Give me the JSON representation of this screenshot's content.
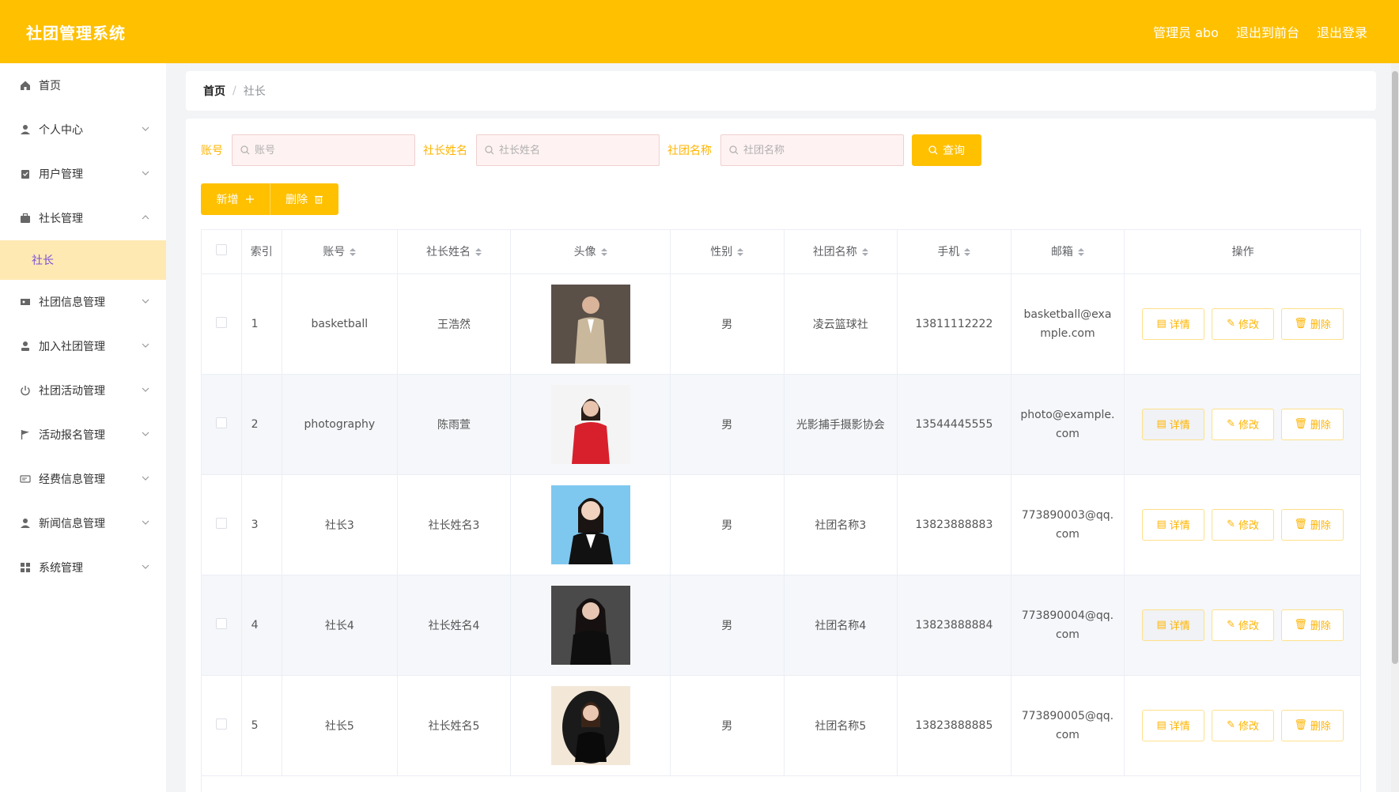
{
  "header": {
    "title": "社团管理系统",
    "admin_label": "管理员 abo",
    "front_label": "退出到前台",
    "logout_label": "退出登录"
  },
  "sidebar": {
    "items": [
      {
        "label": "首页",
        "icon": "home-icon"
      },
      {
        "label": "个人中心",
        "icon": "user-icon"
      },
      {
        "label": "用户管理",
        "icon": "clipboard-icon"
      },
      {
        "label": "社长管理",
        "icon": "briefcase-icon"
      },
      {
        "label": "社团信息管理",
        "icon": "ticket-icon"
      },
      {
        "label": "加入社团管理",
        "icon": "person-icon"
      },
      {
        "label": "社团活动管理",
        "icon": "power-icon"
      },
      {
        "label": "活动报名管理",
        "icon": "flag-icon"
      },
      {
        "label": "经费信息管理",
        "icon": "card-icon"
      },
      {
        "label": "新闻信息管理",
        "icon": "person-icon"
      },
      {
        "label": "系统管理",
        "icon": "grid-icon"
      }
    ],
    "sub_item": "社长"
  },
  "breadcrumb": {
    "home": "首页",
    "sep": "/",
    "current": "社长"
  },
  "search": {
    "account_label": "账号",
    "account_placeholder": "账号",
    "name_label": "社长姓名",
    "name_placeholder": "社长姓名",
    "club_label": "社团名称",
    "club_placeholder": "社团名称",
    "query_label": "查询"
  },
  "actions": {
    "add_label": "新增",
    "delete_label": "删除"
  },
  "table": {
    "headers": {
      "index": "索引",
      "account": "账号",
      "name": "社长姓名",
      "avatar": "头像",
      "gender": "性别",
      "club": "社团名称",
      "phone": "手机",
      "email": "邮箱",
      "ops": "操作"
    },
    "op_labels": {
      "detail": "详情",
      "edit": "修改",
      "delete": "删除"
    },
    "rows": [
      {
        "index": "1",
        "account": "basketball",
        "name": "王浩然",
        "gender": "男",
        "club": "凌云篮球社",
        "phone": "13811112222",
        "email": "basketball@example.com"
      },
      {
        "index": "2",
        "account": "photography",
        "name": "陈雨萱",
        "gender": "男",
        "club": "光影捕手摄影协会",
        "phone": "13544445555",
        "email": "photo@example.com"
      },
      {
        "index": "3",
        "account": "社长3",
        "name": "社长姓名3",
        "gender": "男",
        "club": "社团名称3",
        "phone": "13823888883",
        "email": "773890003@qq.com"
      },
      {
        "index": "4",
        "account": "社长4",
        "name": "社长姓名4",
        "gender": "男",
        "club": "社团名称4",
        "phone": "13823888884",
        "email": "773890004@qq.com"
      },
      {
        "index": "5",
        "account": "社长5",
        "name": "社长姓名5",
        "gender": "男",
        "club": "社团名称5",
        "phone": "13823888885",
        "email": "773890005@qq.com"
      }
    ]
  },
  "colors": {
    "accent": "#ffc000",
    "active_bg": "#ffe9b3",
    "active_text": "#7a4fd6"
  }
}
